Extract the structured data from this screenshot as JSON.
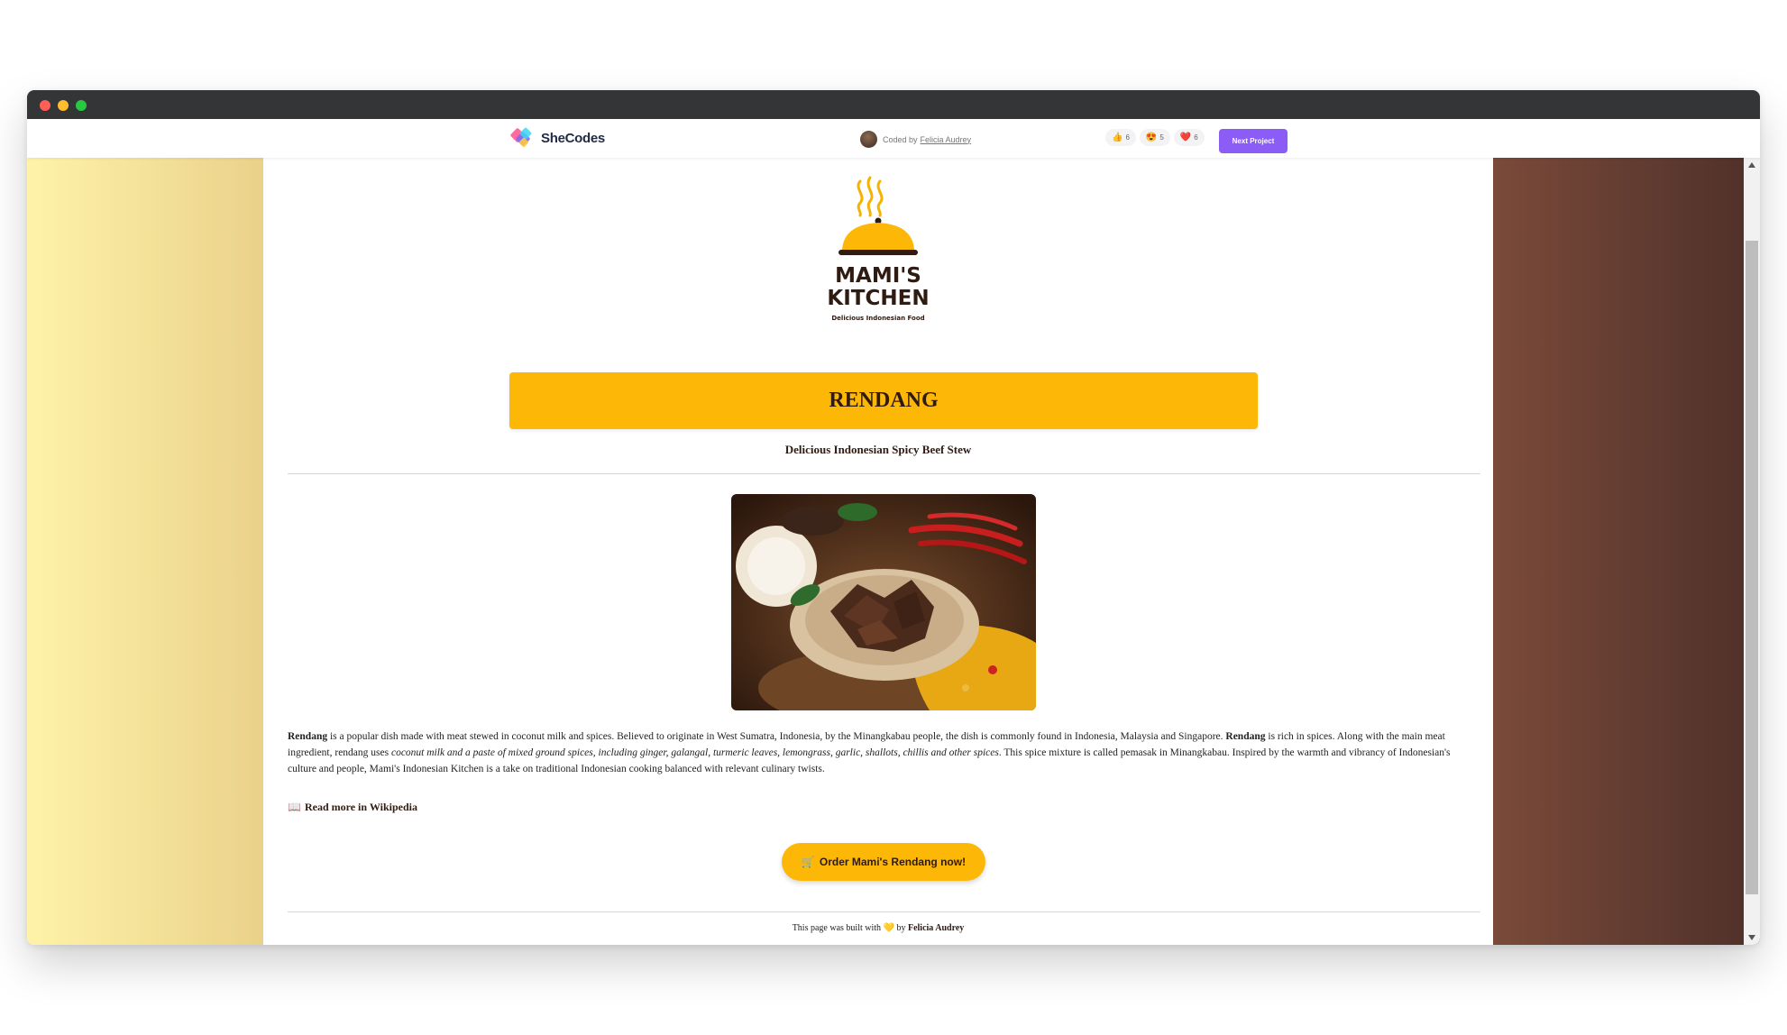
{
  "topbar": {
    "brand": "SheCodes",
    "coded_by_prefix": "Coded by",
    "coded_by_name": "Felicia Audrey",
    "reactions": [
      {
        "icon": "👍",
        "count": "6"
      },
      {
        "icon": "😍",
        "count": "5"
      },
      {
        "icon": "❤️",
        "count": "6"
      }
    ],
    "next_button": "Next Project"
  },
  "site": {
    "logo_line1": "MAMI'S",
    "logo_line2": "KITCHEN",
    "logo_tagline": "Delicious Indonesian Food",
    "dish_title": "RENDANG",
    "dish_subtitle": "Delicious Indonesian Spicy Beef Stew",
    "desc_b1": "Rendang",
    "desc_t1": " is a popular dish made with meat stewed in coconut milk and spices. Believed to originate in West Sumatra, Indonesia, by the Minangkabau people, the dish is commonly found in Indonesia, Malaysia and Singapore. ",
    "desc_b2": "Rendang",
    "desc_t2": " is rich in spices. Along with the main meat ingredient, rendang uses ",
    "desc_i1": "coconut milk and a paste of mixed ground spices, including ginger, galangal, turmeric leaves, lemongrass, garlic, shallots, chillis and other spices",
    "desc_t3": ". This spice mixture is called pemasak in Minangkabau. Inspired by the warmth and vibrancy of Indonesian's culture and people, Mami's Indonesian Kitchen is a take on traditional Indonesian cooking balanced with relevant culinary twists.",
    "wiki_icon": "📖",
    "wiki_link": "Read more in Wikipedia",
    "order_icon": "🛒",
    "order_button": "Order Mami's Rendang now!",
    "footer_prefix": "This page was built with",
    "footer_heart": "💛",
    "footer_by": "by",
    "footer_author": "Felicia Audrey"
  },
  "colors": {
    "accent": "#fdb706",
    "brown": "#2f1b12",
    "purple": "#8b5cf6"
  }
}
